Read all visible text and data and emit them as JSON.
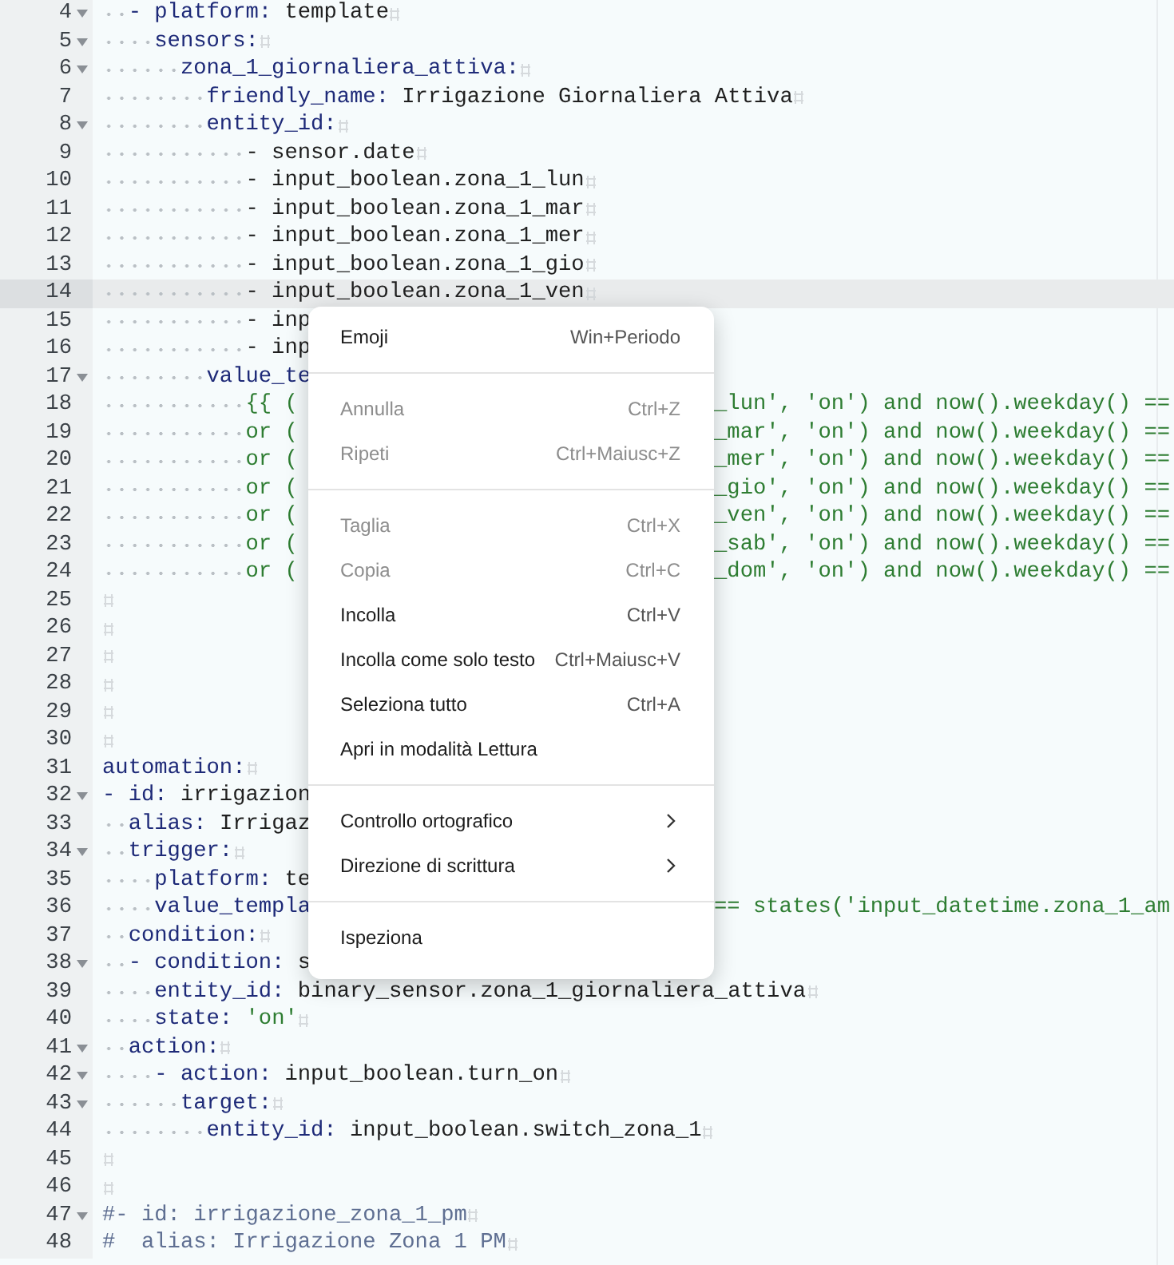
{
  "editor": {
    "lines": [
      {
        "number": "4",
        "foldable": true,
        "current": false,
        "eol": true,
        "segments": [
          {
            "text": "  - platform:",
            "kind": "key"
          },
          {
            "text": " template",
            "kind": "text"
          }
        ]
      },
      {
        "number": "5",
        "foldable": true,
        "current": false,
        "eol": true,
        "segments": [
          {
            "text": "    sensors:",
            "kind": "key"
          }
        ]
      },
      {
        "number": "6",
        "foldable": true,
        "current": false,
        "eol": true,
        "segments": [
          {
            "text": "      zona_1_giornaliera_attiva:",
            "kind": "key"
          }
        ]
      },
      {
        "number": "7",
        "foldable": false,
        "current": false,
        "eol": true,
        "segments": [
          {
            "text": "        friendly_name:",
            "kind": "key"
          },
          {
            "text": " Irrigazione Giornaliera Attiva",
            "kind": "text"
          }
        ]
      },
      {
        "number": "8",
        "foldable": true,
        "current": false,
        "eol": true,
        "segments": [
          {
            "text": "        entity_id:",
            "kind": "key"
          }
        ]
      },
      {
        "number": "9",
        "foldable": false,
        "current": false,
        "eol": true,
        "segments": [
          {
            "text": "           - sensor.date",
            "kind": "text"
          }
        ]
      },
      {
        "number": "10",
        "foldable": false,
        "current": false,
        "eol": true,
        "segments": [
          {
            "text": "           - input_boolean.zona_1_lun",
            "kind": "text"
          }
        ]
      },
      {
        "number": "11",
        "foldable": false,
        "current": false,
        "eol": true,
        "segments": [
          {
            "text": "           - input_boolean.zona_1_mar",
            "kind": "text"
          }
        ]
      },
      {
        "number": "12",
        "foldable": false,
        "current": false,
        "eol": true,
        "segments": [
          {
            "text": "           - input_boolean.zona_1_mer",
            "kind": "text"
          }
        ]
      },
      {
        "number": "13",
        "foldable": false,
        "current": false,
        "eol": true,
        "segments": [
          {
            "text": "           - input_boolean.zona_1_gio",
            "kind": "text"
          }
        ]
      },
      {
        "number": "14",
        "foldable": false,
        "current": true,
        "eol": true,
        "segments": [
          {
            "text": "           - input_boolean.zona_1_ven",
            "kind": "text"
          }
        ]
      },
      {
        "number": "15",
        "foldable": false,
        "current": false,
        "eol": false,
        "segments": [
          {
            "text": "           - inp",
            "kind": "text"
          }
        ]
      },
      {
        "number": "16",
        "foldable": false,
        "current": false,
        "eol": false,
        "segments": [
          {
            "text": "           - inp",
            "kind": "text"
          }
        ]
      },
      {
        "number": "17",
        "foldable": true,
        "current": false,
        "eol": false,
        "segments": [
          {
            "text": "        value_te",
            "kind": "key"
          }
        ]
      },
      {
        "number": "18",
        "foldable": false,
        "current": false,
        "eol": false,
        "segments": [
          {
            "text": "           {{ (",
            "kind": "string"
          }
        ],
        "right": [
          {
            "text": "_lun', 'on') and now().weekday() ==",
            "kind": "string"
          }
        ]
      },
      {
        "number": "19",
        "foldable": false,
        "current": false,
        "eol": false,
        "segments": [
          {
            "text": "           or (",
            "kind": "string"
          }
        ],
        "right": [
          {
            "text": "_mar', 'on') and now().weekday() ==",
            "kind": "string"
          }
        ]
      },
      {
        "number": "20",
        "foldable": false,
        "current": false,
        "eol": false,
        "segments": [
          {
            "text": "           or (",
            "kind": "string"
          }
        ],
        "right": [
          {
            "text": "_mer', 'on') and now().weekday() ==",
            "kind": "string"
          }
        ]
      },
      {
        "number": "21",
        "foldable": false,
        "current": false,
        "eol": false,
        "segments": [
          {
            "text": "           or (",
            "kind": "string"
          }
        ],
        "right": [
          {
            "text": "_gio', 'on') and now().weekday() ==",
            "kind": "string"
          }
        ]
      },
      {
        "number": "22",
        "foldable": false,
        "current": false,
        "eol": false,
        "segments": [
          {
            "text": "           or (",
            "kind": "string"
          }
        ],
        "right": [
          {
            "text": "_ven', 'on') and now().weekday() ==",
            "kind": "string"
          }
        ]
      },
      {
        "number": "23",
        "foldable": false,
        "current": false,
        "eol": false,
        "segments": [
          {
            "text": "           or (",
            "kind": "string"
          }
        ],
        "right": [
          {
            "text": "_sab', 'on') and now().weekday() ==",
            "kind": "string"
          }
        ]
      },
      {
        "number": "24",
        "foldable": false,
        "current": false,
        "eol": false,
        "segments": [
          {
            "text": "           or (",
            "kind": "string"
          }
        ],
        "right": [
          {
            "text": "_dom', 'on') and now().weekday() ==",
            "kind": "string"
          }
        ]
      },
      {
        "number": "25",
        "foldable": false,
        "current": false,
        "eol": true
      },
      {
        "number": "26",
        "foldable": false,
        "current": false,
        "eol": true
      },
      {
        "number": "27",
        "foldable": false,
        "current": false,
        "eol": true
      },
      {
        "number": "28",
        "foldable": false,
        "current": false,
        "eol": true
      },
      {
        "number": "29",
        "foldable": false,
        "current": false,
        "eol": true
      },
      {
        "number": "30",
        "foldable": false,
        "current": false,
        "eol": true
      },
      {
        "number": "31",
        "foldable": false,
        "current": false,
        "eol": true,
        "segments": [
          {
            "text": "automation:",
            "kind": "key"
          }
        ]
      },
      {
        "number": "32",
        "foldable": true,
        "current": false,
        "eol": false,
        "segments": [
          {
            "text": "- id:",
            "kind": "key"
          },
          {
            "text": " irrigazion",
            "kind": "text"
          }
        ]
      },
      {
        "number": "33",
        "foldable": false,
        "current": false,
        "eol": false,
        "segments": [
          {
            "text": "  alias:",
            "kind": "key"
          },
          {
            "text": " Irrigaz",
            "kind": "text"
          }
        ]
      },
      {
        "number": "34",
        "foldable": true,
        "current": false,
        "eol": true,
        "segments": [
          {
            "text": "  trigger:",
            "kind": "key"
          }
        ]
      },
      {
        "number": "35",
        "foldable": false,
        "current": false,
        "eol": false,
        "segments": [
          {
            "text": "    platform:",
            "kind": "key"
          },
          {
            "text": " te",
            "kind": "text"
          }
        ]
      },
      {
        "number": "36",
        "foldable": false,
        "current": false,
        "eol": false,
        "segments": [
          {
            "text": "    value_templa",
            "kind": "key"
          }
        ],
        "right": [
          {
            "text": "== states('input_datetime.zona_1_am",
            "kind": "string"
          }
        ]
      },
      {
        "number": "37",
        "foldable": false,
        "current": false,
        "eol": true,
        "segments": [
          {
            "text": "  condition:",
            "kind": "key"
          }
        ]
      },
      {
        "number": "38",
        "foldable": true,
        "current": false,
        "eol": false,
        "segments": [
          {
            "text": "  - condition:",
            "kind": "key"
          },
          {
            "text": " s",
            "kind": "text"
          }
        ]
      },
      {
        "number": "39",
        "foldable": false,
        "current": false,
        "eol": true,
        "segments": [
          {
            "text": "    entity_id:",
            "kind": "key"
          },
          {
            "text": " binary_sensor.zona_1_giornaliera_attiva",
            "kind": "text"
          }
        ]
      },
      {
        "number": "40",
        "foldable": false,
        "current": false,
        "eol": true,
        "segments": [
          {
            "text": "    state:",
            "kind": "key"
          },
          {
            "text": " 'on'",
            "kind": "string"
          }
        ]
      },
      {
        "number": "41",
        "foldable": true,
        "current": false,
        "eol": true,
        "segments": [
          {
            "text": "  action:",
            "kind": "key"
          }
        ]
      },
      {
        "number": "42",
        "foldable": true,
        "current": false,
        "eol": true,
        "segments": [
          {
            "text": "    - action:",
            "kind": "key"
          },
          {
            "text": " input_boolean.turn_on",
            "kind": "text"
          }
        ]
      },
      {
        "number": "43",
        "foldable": true,
        "current": false,
        "eol": true,
        "segments": [
          {
            "text": "      target:",
            "kind": "key"
          }
        ]
      },
      {
        "number": "44",
        "foldable": false,
        "current": false,
        "eol": true,
        "segments": [
          {
            "text": "        entity_id:",
            "kind": "key"
          },
          {
            "text": " input_boolean.switch_zona_1",
            "kind": "text"
          }
        ]
      },
      {
        "number": "45",
        "foldable": false,
        "current": false,
        "eol": true
      },
      {
        "number": "46",
        "foldable": false,
        "current": false,
        "eol": true
      },
      {
        "number": "47",
        "foldable": true,
        "current": false,
        "eol": true,
        "segments": [
          {
            "text": "#- id: irrigazione_zona_1_pm",
            "kind": "comment"
          }
        ]
      },
      {
        "number": "48",
        "foldable": false,
        "current": false,
        "eol": true,
        "segments": [
          {
            "text": "#  alias: Irrigazione Zona 1 PM",
            "kind": "comment"
          }
        ]
      }
    ]
  },
  "context_menu": {
    "groups": [
      [
        {
          "label": "Emoji",
          "shortcut": "Win+Periodo",
          "disabled": false,
          "submenu": false
        }
      ],
      [
        {
          "label": "Annulla",
          "shortcut": "Ctrl+Z",
          "disabled": true,
          "submenu": false
        },
        {
          "label": "Ripeti",
          "shortcut": "Ctrl+Maiusc+Z",
          "disabled": true,
          "submenu": false
        }
      ],
      [
        {
          "label": "Taglia",
          "shortcut": "Ctrl+X",
          "disabled": true,
          "submenu": false
        },
        {
          "label": "Copia",
          "shortcut": "Ctrl+C",
          "disabled": true,
          "submenu": false
        },
        {
          "label": "Incolla",
          "shortcut": "Ctrl+V",
          "disabled": false,
          "submenu": false
        },
        {
          "label": "Incolla come solo testo",
          "shortcut": "Ctrl+Maiusc+V",
          "disabled": false,
          "submenu": false
        },
        {
          "label": "Seleziona tutto",
          "shortcut": "Ctrl+A",
          "disabled": false,
          "submenu": false
        },
        {
          "label": "Apri in modalità Lettura",
          "disabled": false,
          "submenu": false
        }
      ],
      [
        {
          "label": "Controllo ortografico",
          "disabled": false,
          "submenu": true
        },
        {
          "label": "Direzione di scrittura",
          "disabled": false,
          "submenu": true
        }
      ],
      [
        {
          "label": "Ispeziona",
          "disabled": false,
          "submenu": false
        }
      ]
    ]
  }
}
